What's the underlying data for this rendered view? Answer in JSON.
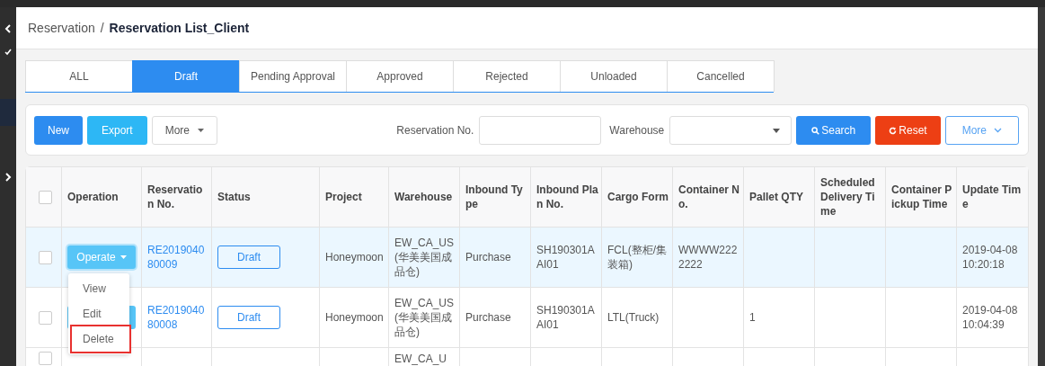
{
  "breadcrumb": {
    "parent": "Reservation",
    "separator": "/",
    "current": "Reservation List_Client"
  },
  "tabs": [
    {
      "label": "ALL",
      "selected": false
    },
    {
      "label": "Draft",
      "selected": true
    },
    {
      "label": "Pending Approval",
      "selected": false
    },
    {
      "label": "Approved",
      "selected": false
    },
    {
      "label": "Rejected",
      "selected": false
    },
    {
      "label": "Unloaded",
      "selected": false
    },
    {
      "label": "Cancelled",
      "selected": false
    }
  ],
  "toolbar": {
    "new": "New",
    "export": "Export",
    "more": "More"
  },
  "filters": {
    "reservation_label": "Reservation No.",
    "warehouse_label": "Warehouse",
    "search": "Search",
    "reset": "Reset",
    "more": "More"
  },
  "table": {
    "all_checked": false,
    "columns": [
      "Operation",
      "Reservation No.",
      "Status",
      "Project",
      "Warehouse",
      "Inbound Type",
      "Inbound Plan No.",
      "Cargo Form",
      "Container No.",
      "Pallet QTY",
      "Scheduled Delivery Time",
      "Container Pickup Time",
      "Update Time"
    ],
    "rows": [
      {
        "checked": false,
        "highlighted": true,
        "has_operate_button": true,
        "operate": "Operate",
        "reservation_no": "RE201904080009",
        "status": "Draft",
        "project": "Honeymoon",
        "warehouse": "EW_CA_US(华美美国成品仓)",
        "inbound_type": "Purchase",
        "inbound_plan_no": "SH190301AAI01",
        "cargo_form": "FCL(整柜/集装箱)",
        "container_no": "WWWW2222222",
        "update_time": "2019-04-08 10:20:18"
      },
      {
        "checked": false,
        "highlighted": false,
        "has_operate_button": true,
        "reservation_no": "RE201904080008",
        "status": "Draft",
        "project": "Honeymoon",
        "warehouse": "EW_CA_US(华美美国成品仓)",
        "inbound_type": "Purchase",
        "inbound_plan_no": "SH190301AAI01",
        "cargo_form": "LTL(Truck)",
        "pallet_qty": "1",
        "update_time": "2019-04-08 10:04:39"
      },
      {
        "checked": false,
        "highlighted": false,
        "has_operate_button": false,
        "warehouse": "EW_CA_U"
      }
    ]
  },
  "operate_menu": [
    {
      "label": "View",
      "marked": false
    },
    {
      "label": "Edit",
      "marked": false
    },
    {
      "label": "Delete",
      "marked": true
    }
  ]
}
